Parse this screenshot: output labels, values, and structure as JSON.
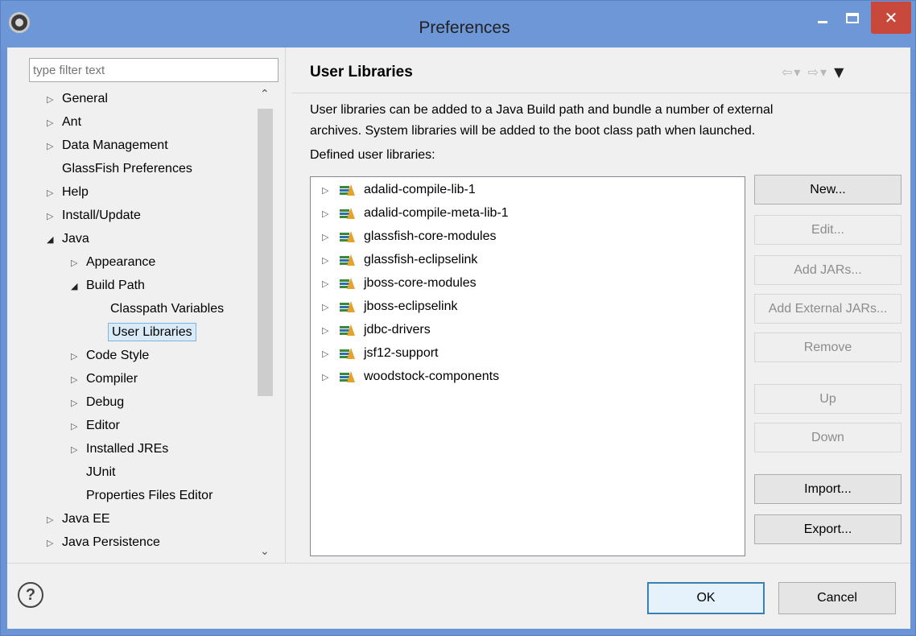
{
  "window": {
    "title": "Preferences",
    "close_glyph": "✕"
  },
  "filter": {
    "placeholder": "type filter text"
  },
  "tree": {
    "items": [
      {
        "label": "General",
        "level": 0,
        "state": "collapsed"
      },
      {
        "label": "Ant",
        "level": 0,
        "state": "collapsed"
      },
      {
        "label": "Data Management",
        "level": 0,
        "state": "collapsed"
      },
      {
        "label": "GlassFish Preferences",
        "level": 0,
        "state": "leaf"
      },
      {
        "label": "Help",
        "level": 0,
        "state": "collapsed"
      },
      {
        "label": "Install/Update",
        "level": 0,
        "state": "collapsed"
      },
      {
        "label": "Java",
        "level": 0,
        "state": "expanded"
      },
      {
        "label": "Appearance",
        "level": 1,
        "state": "collapsed"
      },
      {
        "label": "Build Path",
        "level": 1,
        "state": "expanded"
      },
      {
        "label": "Classpath Variables",
        "level": 2,
        "state": "leaf"
      },
      {
        "label": "User Libraries",
        "level": 2,
        "state": "leaf",
        "selected": true
      },
      {
        "label": "Code Style",
        "level": 1,
        "state": "collapsed"
      },
      {
        "label": "Compiler",
        "level": 1,
        "state": "collapsed"
      },
      {
        "label": "Debug",
        "level": 1,
        "state": "collapsed"
      },
      {
        "label": "Editor",
        "level": 1,
        "state": "collapsed"
      },
      {
        "label": "Installed JREs",
        "level": 1,
        "state": "collapsed"
      },
      {
        "label": "JUnit",
        "level": 1,
        "state": "leaf"
      },
      {
        "label": "Properties Files Editor",
        "level": 1,
        "state": "leaf"
      },
      {
        "label": "Java EE",
        "level": 0,
        "state": "collapsed"
      },
      {
        "label": "Java Persistence",
        "level": 0,
        "state": "collapsed"
      }
    ]
  },
  "page": {
    "title": "User Libraries",
    "description_line1": "User libraries can be added to a Java Build path and bundle a number of external",
    "description_line2": "archives. System libraries will be added to the boot class path when launched.",
    "defined_label": "Defined user libraries:"
  },
  "libraries": [
    "adalid-compile-lib-1",
    "adalid-compile-meta-lib-1",
    "glassfish-core-modules",
    "glassfish-eclipselink",
    "jboss-core-modules",
    "jboss-eclipselink",
    "jdbc-drivers",
    "jsf12-support",
    "woodstock-components"
  ],
  "buttons": {
    "new": "New...",
    "edit": "Edit...",
    "add_jars": "Add JARs...",
    "add_external_jars": "Add External JARs...",
    "remove": "Remove",
    "up": "Up",
    "down": "Down",
    "import": "Import...",
    "export": "Export..."
  },
  "footer": {
    "help_glyph": "?",
    "ok": "OK",
    "cancel": "Cancel"
  }
}
